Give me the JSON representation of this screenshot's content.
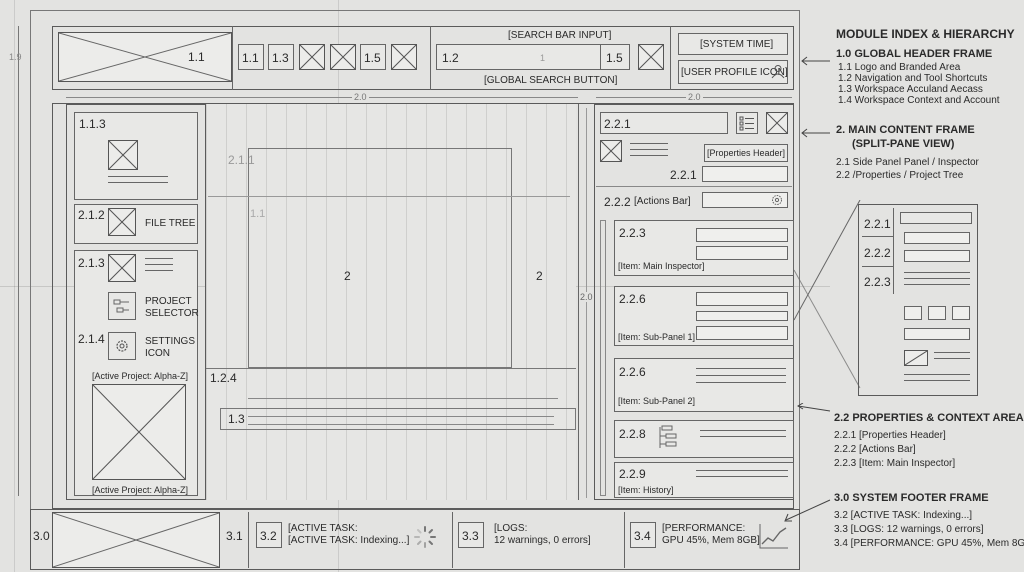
{
  "header": {
    "logo_id": "1.1",
    "nav_ids": [
      "1.1",
      "1.3",
      "1.5"
    ],
    "search_label": "[SEARCH BAR INPUT]",
    "search_left_id": "1.2",
    "search_mid_id": "1",
    "search_right_id": "1.5",
    "search_button_label": "[GLOBAL SEARCH BUTTON]",
    "system_time": "[SYSTEM TIME]",
    "user_profile": "[USER PROFILE ICON]"
  },
  "dims": {
    "left_height": "1.9",
    "main_width": "2.0",
    "right_width": "2.0",
    "right_height": "2.0"
  },
  "side": {
    "s113": "1.1.3",
    "s212": "2.1.2",
    "file_tree": "FILE TREE",
    "s213": "2.1.3",
    "project_selector": "PROJECT\nSELECTOR",
    "s214": "2.1.4",
    "settings_icon": "SETTINGS\nICON",
    "active_project_1": "[Active Project: Alpha-Z]",
    "active_project_2": "[Active Project: Alpha-Z]"
  },
  "main": {
    "s211": "2.1.1",
    "s11": "1.1",
    "two_a": "2",
    "two_b": "2",
    "s124": "1.2.4",
    "s13": "1.3"
  },
  "props": {
    "s221": "2.2.1",
    "properties_header": "[Properties Header]",
    "s221b": "2.2.1",
    "s222": "2.2.2",
    "actions_bar": "[Actions Bar]",
    "s223": "2.2.3",
    "main_inspector": "[Item: Main Inspector]",
    "s226a": "2.2.6",
    "sub_panel_1": "[Item: Sub-Panel 1]",
    "s226b": "2.2.6",
    "sub_panel_2": "[Item: Sub-Panel 2]",
    "s228": "2.2.8",
    "s229": "2.2.9",
    "history": "[Item: History]"
  },
  "footer": {
    "s30": "3.0",
    "s31": "3.1",
    "s32": "3.2",
    "active_task": "[ACTIVE TASK:\n[ACTIVE TASK: Indexing...]",
    "s33": "3.3",
    "logs": "[LOGS:\n12 warnings, 0 errors]",
    "s34": "3.4",
    "performance": "[PERFORMANCE:\nGPU 45%, Mem 8GB]"
  },
  "zoom": {
    "z1": "2.2.1",
    "z2": "2.2.2",
    "z3": "2.2.3"
  },
  "legend": {
    "title": "MODULE INDEX & HIERARCHY",
    "sec1_title": "1.0 GLOBAL HEADER FRAME",
    "sec1_items": [
      "1.1 Logo and Branded Area",
      "1.2 Navigation and Tool Shortcuts",
      "1.3 Workspace Acculand Aecass",
      "1.4 Workspace Context and Account"
    ],
    "sec2_title": "2. MAIN CONTENT FRAME",
    "sec2_sub": "(SPLIT-PANE VIEW)",
    "sec2_items": [
      "2.1 Side Panel Panel / Inspector",
      "2.2 /Properties / Project Tree"
    ],
    "sec22_title": "2.2 PROPERTIES & CONTEXT AREA",
    "sec22_items": [
      "2.2.1 [Properties Header]",
      "2.2.2 [Actions Bar]",
      "2.2.3 [Item: Main Inspector]"
    ],
    "sec3_title": "3.0 SYSTEM FOOTER FRAME",
    "sec3_items": [
      "3.2 [ACTIVE TASK: Indexing...]",
      "3.3 [LOGS: 12 warnings, 0 errors]",
      "3.4 [PERFORMANCE: GPU 45%, Mem 8GB]"
    ]
  }
}
